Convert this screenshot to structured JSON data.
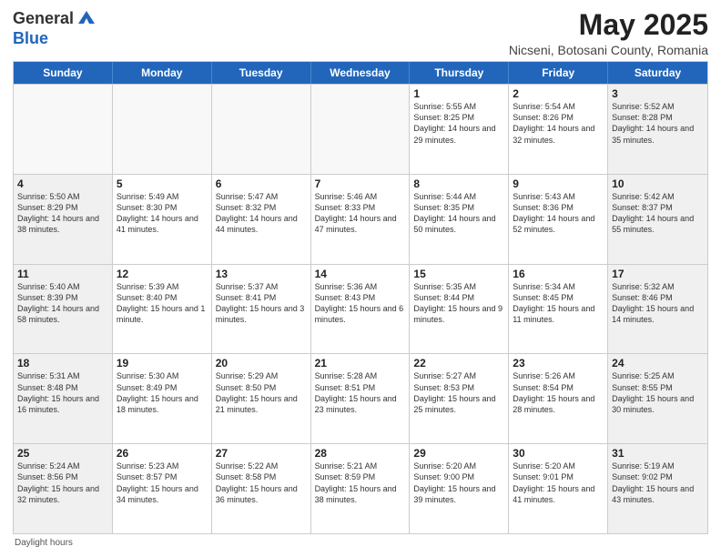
{
  "header": {
    "logo_general": "General",
    "logo_blue": "Blue",
    "month_title": "May 2025",
    "subtitle": "Nicseni, Botosani County, Romania"
  },
  "days_of_week": [
    "Sunday",
    "Monday",
    "Tuesday",
    "Wednesday",
    "Thursday",
    "Friday",
    "Saturday"
  ],
  "weeks": [
    [
      {
        "day": "",
        "text": "",
        "empty": true
      },
      {
        "day": "",
        "text": "",
        "empty": true
      },
      {
        "day": "",
        "text": "",
        "empty": true
      },
      {
        "day": "",
        "text": "",
        "empty": true
      },
      {
        "day": "1",
        "text": "Sunrise: 5:55 AM\nSunset: 8:25 PM\nDaylight: 14 hours\nand 29 minutes.",
        "empty": false
      },
      {
        "day": "2",
        "text": "Sunrise: 5:54 AM\nSunset: 8:26 PM\nDaylight: 14 hours\nand 32 minutes.",
        "empty": false
      },
      {
        "day": "3",
        "text": "Sunrise: 5:52 AM\nSunset: 8:28 PM\nDaylight: 14 hours\nand 35 minutes.",
        "empty": false
      }
    ],
    [
      {
        "day": "4",
        "text": "Sunrise: 5:50 AM\nSunset: 8:29 PM\nDaylight: 14 hours\nand 38 minutes.",
        "empty": false
      },
      {
        "day": "5",
        "text": "Sunrise: 5:49 AM\nSunset: 8:30 PM\nDaylight: 14 hours\nand 41 minutes.",
        "empty": false
      },
      {
        "day": "6",
        "text": "Sunrise: 5:47 AM\nSunset: 8:32 PM\nDaylight: 14 hours\nand 44 minutes.",
        "empty": false
      },
      {
        "day": "7",
        "text": "Sunrise: 5:46 AM\nSunset: 8:33 PM\nDaylight: 14 hours\nand 47 minutes.",
        "empty": false
      },
      {
        "day": "8",
        "text": "Sunrise: 5:44 AM\nSunset: 8:35 PM\nDaylight: 14 hours\nand 50 minutes.",
        "empty": false
      },
      {
        "day": "9",
        "text": "Sunrise: 5:43 AM\nSunset: 8:36 PM\nDaylight: 14 hours\nand 52 minutes.",
        "empty": false
      },
      {
        "day": "10",
        "text": "Sunrise: 5:42 AM\nSunset: 8:37 PM\nDaylight: 14 hours\nand 55 minutes.",
        "empty": false
      }
    ],
    [
      {
        "day": "11",
        "text": "Sunrise: 5:40 AM\nSunset: 8:39 PM\nDaylight: 14 hours\nand 58 minutes.",
        "empty": false
      },
      {
        "day": "12",
        "text": "Sunrise: 5:39 AM\nSunset: 8:40 PM\nDaylight: 15 hours\nand 1 minute.",
        "empty": false
      },
      {
        "day": "13",
        "text": "Sunrise: 5:37 AM\nSunset: 8:41 PM\nDaylight: 15 hours\nand 3 minutes.",
        "empty": false
      },
      {
        "day": "14",
        "text": "Sunrise: 5:36 AM\nSunset: 8:43 PM\nDaylight: 15 hours\nand 6 minutes.",
        "empty": false
      },
      {
        "day": "15",
        "text": "Sunrise: 5:35 AM\nSunset: 8:44 PM\nDaylight: 15 hours\nand 9 minutes.",
        "empty": false
      },
      {
        "day": "16",
        "text": "Sunrise: 5:34 AM\nSunset: 8:45 PM\nDaylight: 15 hours\nand 11 minutes.",
        "empty": false
      },
      {
        "day": "17",
        "text": "Sunrise: 5:32 AM\nSunset: 8:46 PM\nDaylight: 15 hours\nand 14 minutes.",
        "empty": false
      }
    ],
    [
      {
        "day": "18",
        "text": "Sunrise: 5:31 AM\nSunset: 8:48 PM\nDaylight: 15 hours\nand 16 minutes.",
        "empty": false
      },
      {
        "day": "19",
        "text": "Sunrise: 5:30 AM\nSunset: 8:49 PM\nDaylight: 15 hours\nand 18 minutes.",
        "empty": false
      },
      {
        "day": "20",
        "text": "Sunrise: 5:29 AM\nSunset: 8:50 PM\nDaylight: 15 hours\nand 21 minutes.",
        "empty": false
      },
      {
        "day": "21",
        "text": "Sunrise: 5:28 AM\nSunset: 8:51 PM\nDaylight: 15 hours\nand 23 minutes.",
        "empty": false
      },
      {
        "day": "22",
        "text": "Sunrise: 5:27 AM\nSunset: 8:53 PM\nDaylight: 15 hours\nand 25 minutes.",
        "empty": false
      },
      {
        "day": "23",
        "text": "Sunrise: 5:26 AM\nSunset: 8:54 PM\nDaylight: 15 hours\nand 28 minutes.",
        "empty": false
      },
      {
        "day": "24",
        "text": "Sunrise: 5:25 AM\nSunset: 8:55 PM\nDaylight: 15 hours\nand 30 minutes.",
        "empty": false
      }
    ],
    [
      {
        "day": "25",
        "text": "Sunrise: 5:24 AM\nSunset: 8:56 PM\nDaylight: 15 hours\nand 32 minutes.",
        "empty": false
      },
      {
        "day": "26",
        "text": "Sunrise: 5:23 AM\nSunset: 8:57 PM\nDaylight: 15 hours\nand 34 minutes.",
        "empty": false
      },
      {
        "day": "27",
        "text": "Sunrise: 5:22 AM\nSunset: 8:58 PM\nDaylight: 15 hours\nand 36 minutes.",
        "empty": false
      },
      {
        "day": "28",
        "text": "Sunrise: 5:21 AM\nSunset: 8:59 PM\nDaylight: 15 hours\nand 38 minutes.",
        "empty": false
      },
      {
        "day": "29",
        "text": "Sunrise: 5:20 AM\nSunset: 9:00 PM\nDaylight: 15 hours\nand 39 minutes.",
        "empty": false
      },
      {
        "day": "30",
        "text": "Sunrise: 5:20 AM\nSunset: 9:01 PM\nDaylight: 15 hours\nand 41 minutes.",
        "empty": false
      },
      {
        "day": "31",
        "text": "Sunrise: 5:19 AM\nSunset: 9:02 PM\nDaylight: 15 hours\nand 43 minutes.",
        "empty": false
      }
    ]
  ],
  "footer": {
    "note": "Daylight hours"
  }
}
